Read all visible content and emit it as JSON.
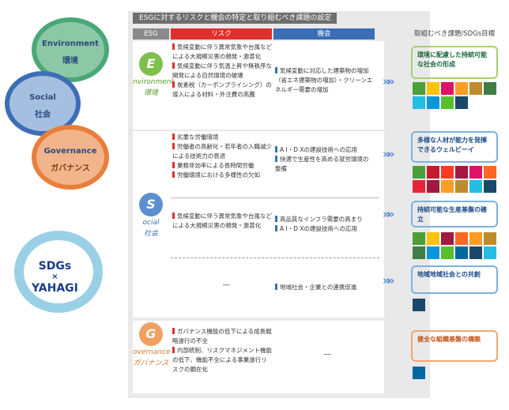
{
  "cycle": {
    "environment": {
      "en": "Environment",
      "jp": "環境"
    },
    "social": {
      "en": "Social",
      "jp": "社会"
    },
    "governance": {
      "en": "Governance",
      "jp": "ガバナンス"
    }
  },
  "logo": {
    "line1": "SDGs",
    "line2": "×",
    "line3": "YAHAGI"
  },
  "table": {
    "title": "ESGに対するリスクと機会の特定と取り組むべき課題の設定",
    "headers": {
      "esg": "ESG",
      "risk": "リスク",
      "opportunity": "機会",
      "goals": "取組むべき課題/SDGs目標"
    },
    "dash": "―"
  },
  "rows": {
    "environment": {
      "letter": "E",
      "label": "nvironment",
      "jp": "環境",
      "risks": [
        "気候変動に伴う異常気象や台風などによる大規模災害の頻発・激甚化",
        "気候変動に伴う気温上昇や無秩序な開発による自然環境の破壊",
        "炭素税（カーボンプライシング）の導入による材料・外注費の高騰"
      ],
      "opportunities": [
        "気候変動に対応した建築物の増加（省エネ建築物の増加）・クリーンエネルギー需要の増加"
      ],
      "goal": "環境に配慮した持続可能な社会の形成"
    },
    "social1": {
      "letter": "S",
      "label": "ocial",
      "jp": "社会",
      "risks": [
        "劣悪な労働環境",
        "労働者の高齢化・若年者の入職減少による技術力の衰退",
        "業務非効率による長時間労働",
        "労働環境における多様性の欠如"
      ],
      "opportunities": [
        "A I・D Xの建設技術への応用",
        "快適で生産性を高める就労環境の整備"
      ],
      "goal": "多様な人材が能力を発揮できるウェルビーイ"
    },
    "social2": {
      "risks": [
        "気候変動に伴う異常気象や台風などによる大規模災害の頻発・激甚化"
      ],
      "opportunities": [
        "高品質なインフラ需要の高まり",
        "A I・D Xの建設技術への応用"
      ],
      "goal": "持続可能な生産基盤の確立"
    },
    "social3": {
      "opportunities": [
        "地域社会・企業との連携促進"
      ],
      "goal": "地域地域社会との共創"
    },
    "governance": {
      "letter": "G",
      "label": "overnance",
      "jp": "ガバナンス",
      "risks": [
        "ガバナンス機能の低下による成長戦略遂行の不全",
        "内部統制、リスクマネジメント機能の低下、機能不全による事業遂行リスクの顕在化"
      ],
      "goal": "健全な組織基盤の構築"
    }
  },
  "colors": {
    "env": "#7fbf4d",
    "soc": "#5b8fd0",
    "gov": "#f0a060",
    "risk": "#e0302c",
    "opp": "#3a6fb7"
  }
}
